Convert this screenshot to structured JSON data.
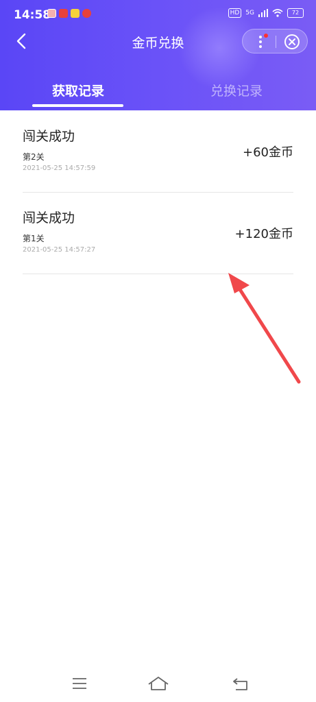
{
  "status_bar": {
    "time": "14:58",
    "hd_label": "HD",
    "network_label": "5G",
    "battery_level": "72"
  },
  "header": {
    "title": "金币兑换",
    "tabs": [
      {
        "label": "获取记录",
        "active": true
      },
      {
        "label": "兑换记录",
        "active": false
      }
    ]
  },
  "records": [
    {
      "title": "闯关成功",
      "level": "第2关",
      "time": "2021-05-25 14:57:59",
      "amount": "+60金币"
    },
    {
      "title": "闯关成功",
      "level": "第1关",
      "time": "2021-05-25 14:57:27",
      "amount": "+120金币"
    }
  ],
  "colors": {
    "header_start": "#5a46f6",
    "header_end": "#7a5cf5",
    "annotation_arrow": "#f0484b"
  },
  "icons": [
    "back-icon",
    "more-icon",
    "close-icon",
    "menu-nav-icon",
    "home-nav-icon",
    "back-nav-icon"
  ]
}
